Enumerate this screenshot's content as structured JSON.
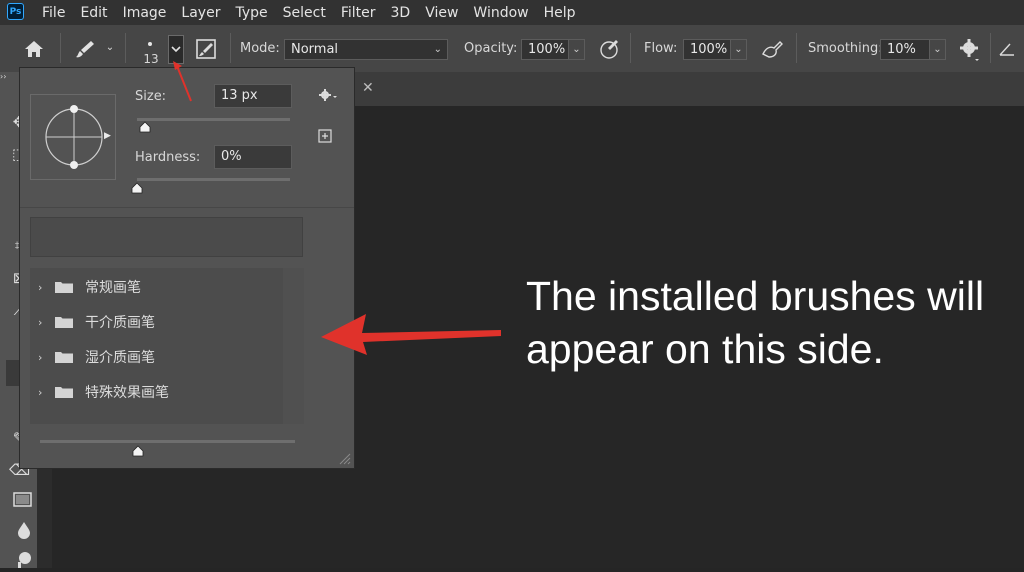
{
  "app": {
    "logo_text": "Ps"
  },
  "menu": {
    "items": [
      "File",
      "Edit",
      "Image",
      "Layer",
      "Type",
      "Select",
      "Filter",
      "3D",
      "View",
      "Window",
      "Help"
    ]
  },
  "options_bar": {
    "brush_size_value": "13",
    "mode_label": "Mode:",
    "mode_value": "Normal",
    "opacity_label": "Opacity:",
    "opacity_value": "100%",
    "flow_label": "Flow:",
    "flow_value": "100%",
    "smoothing_label": "Smoothing:",
    "smoothing_value": "10%"
  },
  "brush_picker": {
    "size_label": "Size:",
    "size_value": "13 px",
    "hardness_label": "Hardness:",
    "hardness_value": "0%",
    "folders": [
      {
        "label": "常规画笔"
      },
      {
        "label": "干介质画笔"
      },
      {
        "label": "湿介质画笔"
      },
      {
        "label": "特殊效果画笔"
      }
    ]
  },
  "annotation": {
    "text": "The installed brushes will appear on this side.",
    "arrow_color": "#e0322b"
  },
  "colors": {
    "menubar": "#323232",
    "options_bar": "#464646",
    "panel": "#535353",
    "canvas": "#262626",
    "accent_ps": "#31a8ff"
  }
}
